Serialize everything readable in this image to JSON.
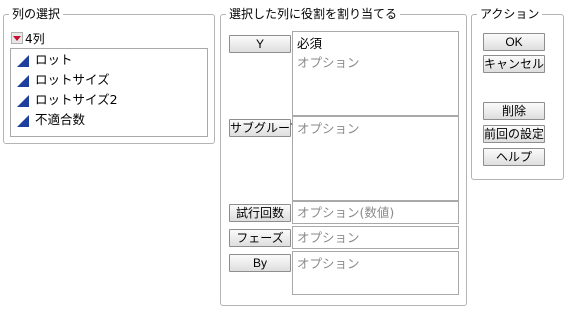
{
  "column_select": {
    "title": "列の選択",
    "count_label": "4列",
    "columns": [
      {
        "label": "ロット",
        "icon": "continuous-column-icon"
      },
      {
        "label": "ロットサイズ",
        "icon": "continuous-column-icon"
      },
      {
        "label": "ロットサイズ2",
        "icon": "continuous-column-icon"
      },
      {
        "label": "不適合数",
        "icon": "continuous-column-icon"
      }
    ]
  },
  "roles": {
    "title": "選択した列に役割を割り当てる",
    "y": {
      "button": "Y",
      "required": "必須",
      "placeholder": "オプション"
    },
    "subgroup": {
      "button": "サブグループ",
      "placeholder": "オプション"
    },
    "trials": {
      "button": "試行回数",
      "placeholder": "オプション(数値)"
    },
    "phase": {
      "button": "フェーズ",
      "placeholder": "オプション"
    },
    "by": {
      "button": "By",
      "placeholder": "オプション"
    }
  },
  "actions": {
    "title": "アクション",
    "ok": "OK",
    "cancel": "キャンセル",
    "remove": "削除",
    "recall": "前回の設定",
    "help": "ヘルプ"
  },
  "colors": {
    "icon_blue": "#1f3f9f",
    "disclosure_red": "#c8102e"
  }
}
